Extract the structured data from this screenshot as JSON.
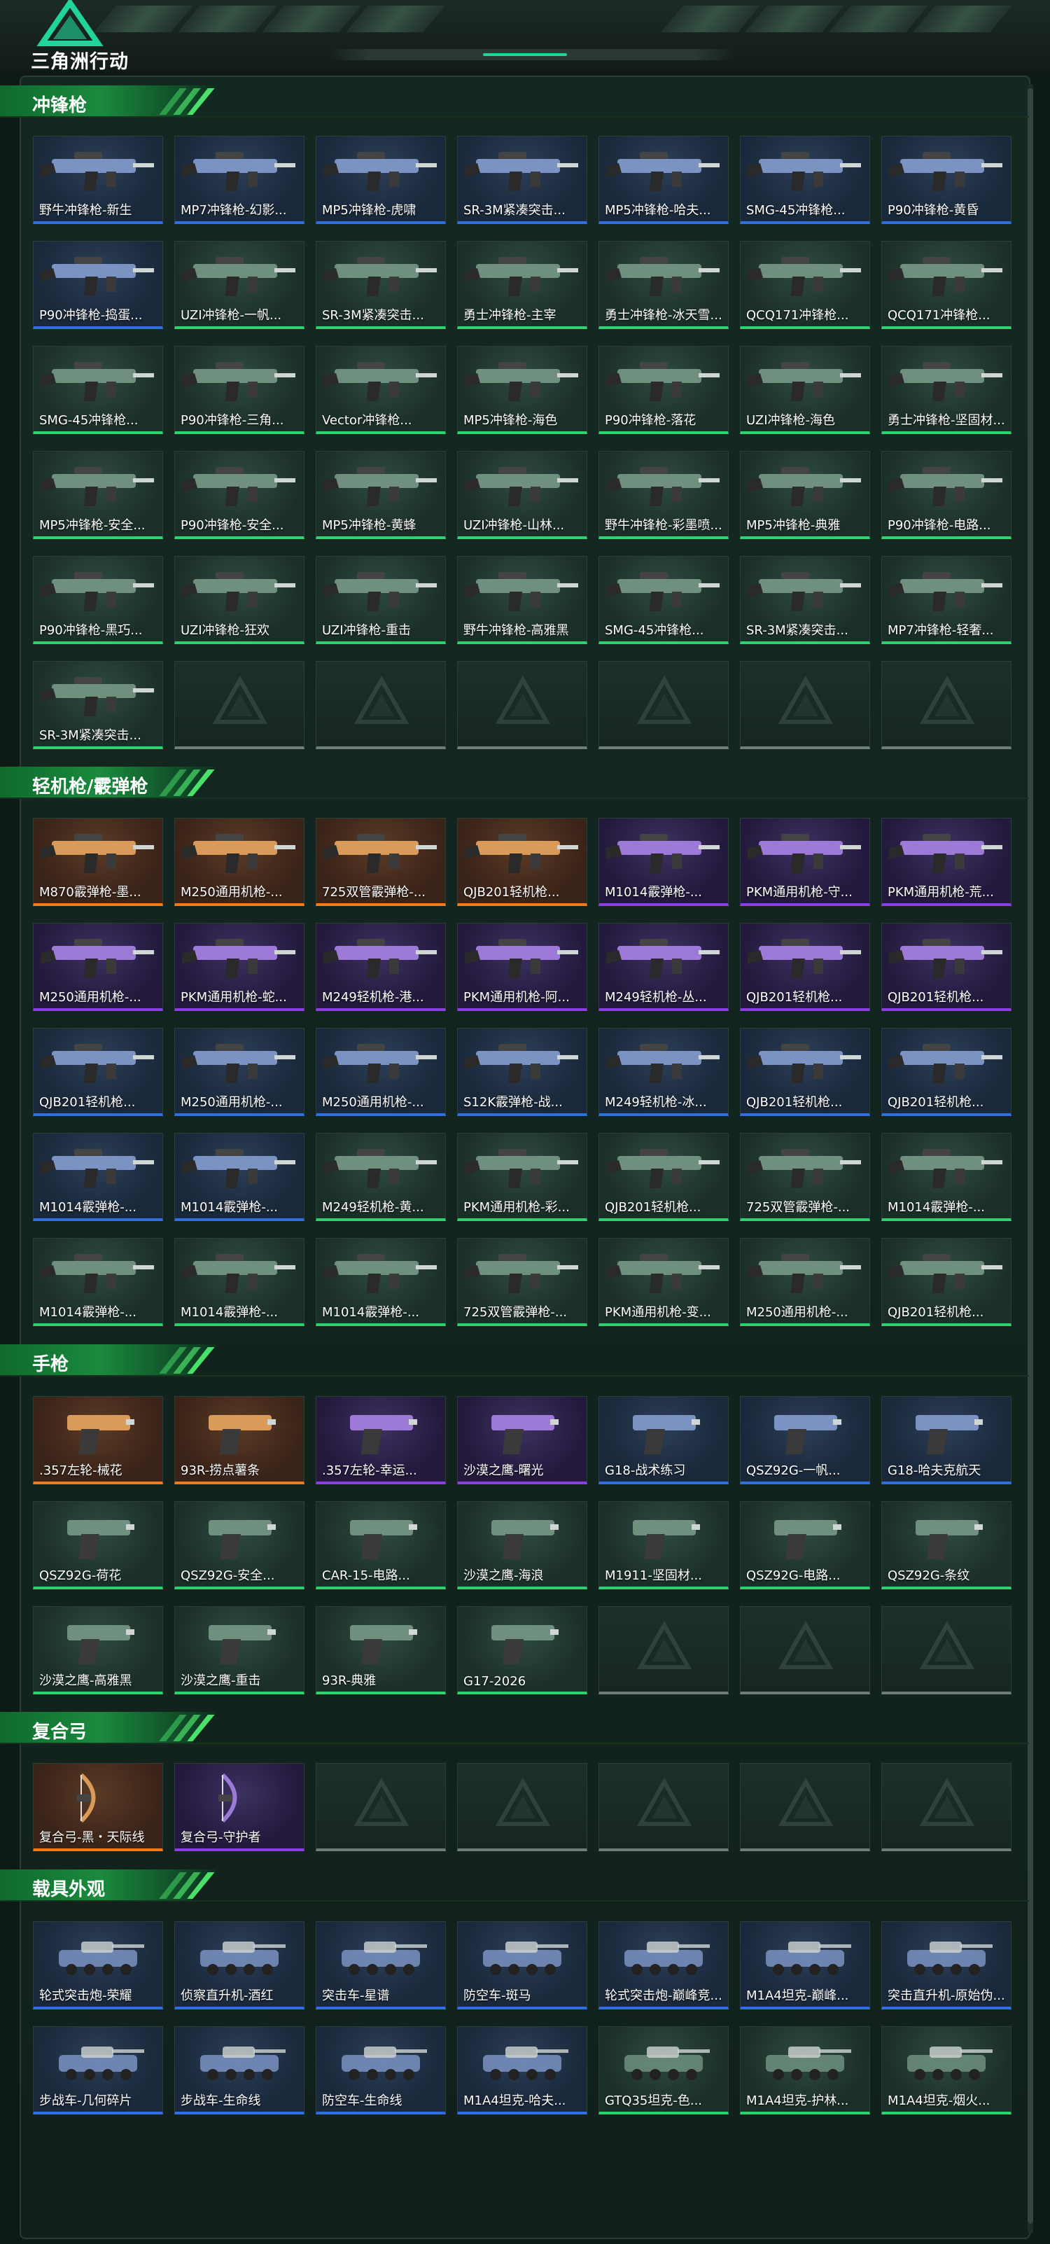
{
  "app": {
    "logo_text": "三角洲行动"
  },
  "colors": {
    "green": "#2fd171",
    "blue": "#2f6fe0",
    "purple": "#8b3fe0",
    "orange": "#f07c1e"
  },
  "sections": [
    {
      "title": "冲锋枪",
      "items": [
        {
          "label": "野牛冲锋枪-新生",
          "rarity": "blue"
        },
        {
          "label": "MP7冲锋枪-幻影...",
          "rarity": "blue"
        },
        {
          "label": "MP5冲锋枪-虎啸",
          "rarity": "blue"
        },
        {
          "label": "SR-3M紧凑突击...",
          "rarity": "blue"
        },
        {
          "label": "MP5冲锋枪-哈夫...",
          "rarity": "blue"
        },
        {
          "label": "SMG-45冲锋枪...",
          "rarity": "blue"
        },
        {
          "label": "P90冲锋枪-黄昏",
          "rarity": "blue"
        },
        {
          "label": "P90冲锋枪-捣蛋...",
          "rarity": "blue"
        },
        {
          "label": "UZI冲锋枪-一帆...",
          "rarity": "green"
        },
        {
          "label": "SR-3M紧凑突击...",
          "rarity": "green"
        },
        {
          "label": "勇士冲锋枪-主宰",
          "rarity": "green"
        },
        {
          "label": "勇士冲锋枪-冰天雪...",
          "rarity": "green"
        },
        {
          "label": "QCQ171冲锋枪...",
          "rarity": "green"
        },
        {
          "label": "QCQ171冲锋枪...",
          "rarity": "green"
        },
        {
          "label": "SMG-45冲锋枪...",
          "rarity": "green"
        },
        {
          "label": "P90冲锋枪-三角...",
          "rarity": "green"
        },
        {
          "label": "Vector冲锋枪...",
          "rarity": "green"
        },
        {
          "label": "MP5冲锋枪-海色",
          "rarity": "green"
        },
        {
          "label": "P90冲锋枪-落花",
          "rarity": "green"
        },
        {
          "label": "UZI冲锋枪-海色",
          "rarity": "green"
        },
        {
          "label": "勇士冲锋枪-坚固材...",
          "rarity": "green"
        },
        {
          "label": "MP5冲锋枪-安全...",
          "rarity": "green"
        },
        {
          "label": "P90冲锋枪-安全...",
          "rarity": "green"
        },
        {
          "label": "MP5冲锋枪-黄蜂",
          "rarity": "green"
        },
        {
          "label": "UZI冲锋枪-山林...",
          "rarity": "green"
        },
        {
          "label": "野牛冲锋枪-彩墨喷...",
          "rarity": "green"
        },
        {
          "label": "MP5冲锋枪-典雅",
          "rarity": "green"
        },
        {
          "label": "P90冲锋枪-电路...",
          "rarity": "green"
        },
        {
          "label": "P90冲锋枪-黑巧...",
          "rarity": "green"
        },
        {
          "label": "UZI冲锋枪-狂欢",
          "rarity": "green"
        },
        {
          "label": "UZI冲锋枪-重击",
          "rarity": "green"
        },
        {
          "label": "野牛冲锋枪-高雅黑",
          "rarity": "green"
        },
        {
          "label": "SMG-45冲锋枪...",
          "rarity": "green"
        },
        {
          "label": "SR-3M紧凑突击...",
          "rarity": "green"
        },
        {
          "label": "MP7冲锋枪-轻奢...",
          "rarity": "green"
        },
        {
          "label": "SR-3M紧凑突击...",
          "rarity": "green"
        },
        {
          "label": "",
          "rarity": "empty"
        },
        {
          "label": "",
          "rarity": "empty"
        },
        {
          "label": "",
          "rarity": "empty"
        },
        {
          "label": "",
          "rarity": "empty"
        },
        {
          "label": "",
          "rarity": "empty"
        },
        {
          "label": "",
          "rarity": "empty"
        }
      ]
    },
    {
      "title": "轻机枪/霰弹枪",
      "items": [
        {
          "label": "M870霰弹枪-墨...",
          "rarity": "orange"
        },
        {
          "label": "M250通用机枪-...",
          "rarity": "orange"
        },
        {
          "label": "725双管霰弹枪-...",
          "rarity": "orange"
        },
        {
          "label": "QJB201轻机枪...",
          "rarity": "orange"
        },
        {
          "label": "M1014霰弹枪-...",
          "rarity": "purple"
        },
        {
          "label": "PKM通用机枪-守...",
          "rarity": "purple"
        },
        {
          "label": "PKM通用机枪-荒...",
          "rarity": "purple"
        },
        {
          "label": "M250通用机枪-...",
          "rarity": "purple"
        },
        {
          "label": "PKM通用机枪-蛇...",
          "rarity": "purple"
        },
        {
          "label": "M249轻机枪-港...",
          "rarity": "purple"
        },
        {
          "label": "PKM通用机枪-阿...",
          "rarity": "purple"
        },
        {
          "label": "M249轻机枪-丛...",
          "rarity": "purple"
        },
        {
          "label": "QJB201轻机枪...",
          "rarity": "purple"
        },
        {
          "label": "QJB201轻机枪...",
          "rarity": "purple"
        },
        {
          "label": "QJB201轻机枪...",
          "rarity": "blue"
        },
        {
          "label": "M250通用机枪-...",
          "rarity": "blue"
        },
        {
          "label": "M250通用机枪-...",
          "rarity": "blue"
        },
        {
          "label": "S12K霰弹枪-战...",
          "rarity": "blue"
        },
        {
          "label": "M249轻机枪-冰...",
          "rarity": "blue"
        },
        {
          "label": "QJB201轻机枪...",
          "rarity": "blue"
        },
        {
          "label": "QJB201轻机枪...",
          "rarity": "blue"
        },
        {
          "label": "M1014霰弹枪-...",
          "rarity": "blue"
        },
        {
          "label": "M1014霰弹枪-...",
          "rarity": "blue"
        },
        {
          "label": "M249轻机枪-黄...",
          "rarity": "green"
        },
        {
          "label": "PKM通用机枪-彩...",
          "rarity": "green"
        },
        {
          "label": "QJB201轻机枪...",
          "rarity": "green"
        },
        {
          "label": "725双管霰弹枪-...",
          "rarity": "green"
        },
        {
          "label": "M1014霰弹枪-...",
          "rarity": "green"
        },
        {
          "label": "M1014霰弹枪-...",
          "rarity": "green"
        },
        {
          "label": "M1014霰弹枪-...",
          "rarity": "green"
        },
        {
          "label": "M1014霰弹枪-...",
          "rarity": "green"
        },
        {
          "label": "725双管霰弹枪-...",
          "rarity": "green"
        },
        {
          "label": "PKM通用机枪-变...",
          "rarity": "green"
        },
        {
          "label": "M250通用机枪-...",
          "rarity": "green"
        },
        {
          "label": "QJB201轻机枪...",
          "rarity": "green"
        }
      ]
    },
    {
      "title": "手枪",
      "items": [
        {
          "label": ".357左轮-械花",
          "rarity": "orange"
        },
        {
          "label": "93R-捞点薯条",
          "rarity": "orange"
        },
        {
          "label": ".357左轮-幸运...",
          "rarity": "purple"
        },
        {
          "label": "沙漠之鹰-曙光",
          "rarity": "purple"
        },
        {
          "label": "G18-战术练习",
          "rarity": "blue"
        },
        {
          "label": "QSZ92G-一帆...",
          "rarity": "blue"
        },
        {
          "label": "G18-哈夫克航天",
          "rarity": "blue"
        },
        {
          "label": "QSZ92G-荷花",
          "rarity": "green"
        },
        {
          "label": "QSZ92G-安全...",
          "rarity": "green"
        },
        {
          "label": "CAR-15-电路...",
          "rarity": "green"
        },
        {
          "label": "沙漠之鹰-海浪",
          "rarity": "green"
        },
        {
          "label": "M1911-坚固材...",
          "rarity": "green"
        },
        {
          "label": "QSZ92G-电路...",
          "rarity": "green"
        },
        {
          "label": "QSZ92G-条纹",
          "rarity": "green"
        },
        {
          "label": "沙漠之鹰-高雅黑",
          "rarity": "green"
        },
        {
          "label": "沙漠之鹰-重击",
          "rarity": "green"
        },
        {
          "label": "93R-典雅",
          "rarity": "green"
        },
        {
          "label": "G17-2026",
          "rarity": "green"
        },
        {
          "label": "",
          "rarity": "empty"
        },
        {
          "label": "",
          "rarity": "empty"
        },
        {
          "label": "",
          "rarity": "empty"
        }
      ]
    },
    {
      "title": "复合弓",
      "items": [
        {
          "label": "复合弓-黑・天际线",
          "rarity": "orange"
        },
        {
          "label": "复合弓-守护者",
          "rarity": "purple"
        },
        {
          "label": "",
          "rarity": "empty"
        },
        {
          "label": "",
          "rarity": "empty"
        },
        {
          "label": "",
          "rarity": "empty"
        },
        {
          "label": "",
          "rarity": "empty"
        },
        {
          "label": "",
          "rarity": "empty"
        }
      ]
    },
    {
      "title": "载具外观",
      "items": [
        {
          "label": "轮式突击炮-荣耀",
          "rarity": "blue"
        },
        {
          "label": "侦察直升机-酒红",
          "rarity": "blue"
        },
        {
          "label": "突击车-星谱",
          "rarity": "blue"
        },
        {
          "label": "防空车-斑马",
          "rarity": "blue"
        },
        {
          "label": "轮式突击炮-巅峰竞...",
          "rarity": "blue"
        },
        {
          "label": "M1A4坦克-巅峰...",
          "rarity": "blue"
        },
        {
          "label": "突击直升机-原始伪...",
          "rarity": "blue"
        },
        {
          "label": "步战车-几何碎片",
          "rarity": "blue"
        },
        {
          "label": "步战车-生命线",
          "rarity": "blue"
        },
        {
          "label": "防空车-生命线",
          "rarity": "blue"
        },
        {
          "label": "M1A4坦克-哈夫...",
          "rarity": "blue"
        },
        {
          "label": "GTQ35坦克-色...",
          "rarity": "green"
        },
        {
          "label": "M1A4坦克-护林...",
          "rarity": "green"
        },
        {
          "label": "M1A4坦克-烟火...",
          "rarity": "green"
        }
      ]
    }
  ]
}
